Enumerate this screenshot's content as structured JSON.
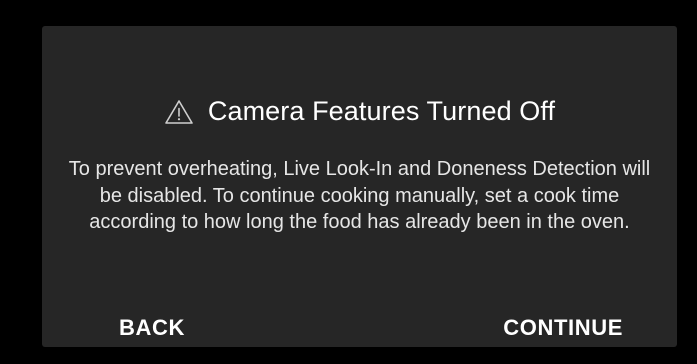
{
  "dialog": {
    "icon": "warning-triangle-icon",
    "title": "Camera Features Turned Off",
    "message": "To prevent overheating, Live Look-In and Doneness Detection will be disabled. To continue cooking manually, set a cook time according to how long the food has already been in the oven.",
    "back_label": "BACK",
    "continue_label": "CONTINUE"
  },
  "colors": {
    "page_background": "#000000",
    "dialog_background": "#262626",
    "text": "#ffffff"
  }
}
